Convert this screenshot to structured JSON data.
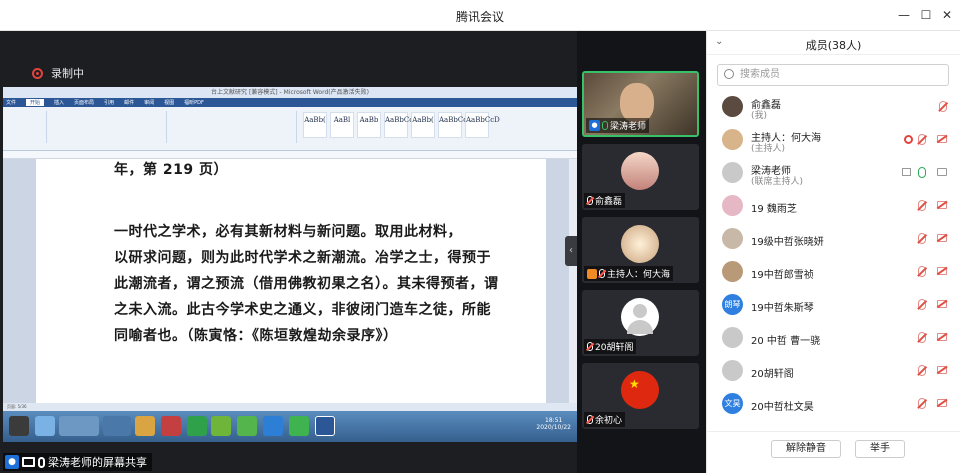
{
  "window": {
    "title": "腾讯会议"
  },
  "recording": {
    "label": "录制中"
  },
  "word": {
    "title": "台上文献研究 [兼容模式] - Microsoft Word(产品激活失败)",
    "menu": [
      "文件",
      "开始",
      "插入",
      "页面布局",
      "引用",
      "邮件",
      "审阅",
      "视图",
      "福昕PDF"
    ],
    "styles": [
      "AaBb(",
      "AaBl",
      "AaBb",
      "AaBbCc",
      "AaBb(",
      "AaBbCcD",
      "AaBbCcD"
    ],
    "doc_lines": [
      "年，第 219 页）",
      "一时代之学术，必有其新材料与新问题。取用此材料，",
      "以研求问题，则为此时代学术之新潮流。冶学之士，得预于",
      "此潮流者，谓之预流（借用佛教初果之名）。其未得预者，谓",
      "之未入流。此古今学术史之通义，非彼闭门造车之徒，所能",
      "同喻者也。（陈寅恪：《陈垣敦煌劫余录序》）"
    ],
    "clock": {
      "time": "18:51",
      "date": "2020/10/22"
    },
    "page_no": "页面: 5/36"
  },
  "share_label": "梁涛老师的屏幕共享",
  "videos": [
    {
      "name": "梁涛老师",
      "active": true
    },
    {
      "name": "俞鑫磊",
      "active": false
    },
    {
      "name": "主持人：何大海",
      "active": false
    },
    {
      "name": "20胡轩阁",
      "active": false
    },
    {
      "name": "余初心",
      "active": false
    }
  ],
  "panel": {
    "title": "成员(38人)",
    "search_placeholder": "搜索成员",
    "members": [
      {
        "name": "俞鑫磊",
        "sub": "(我)",
        "avatar_text": ""
      },
      {
        "name": "主持人：何大海",
        "sub": "(主持人)",
        "avatar_text": ""
      },
      {
        "name": "梁涛老师",
        "sub": "(联席主持人)",
        "avatar_text": ""
      },
      {
        "name": "19 魏雨芝",
        "sub": "",
        "avatar_text": ""
      },
      {
        "name": "19级中哲张晓妍",
        "sub": "",
        "avatar_text": ""
      },
      {
        "name": "19中哲郎雪祯",
        "sub": "",
        "avatar_text": ""
      },
      {
        "name": "19中哲朱斯琴",
        "sub": "",
        "avatar_text": "朗琴"
      },
      {
        "name": "20 中哲 曹一骁",
        "sub": "",
        "avatar_text": ""
      },
      {
        "name": "20胡轩阁",
        "sub": "",
        "avatar_text": ""
      },
      {
        "name": "20中哲杜文昊",
        "sub": "",
        "avatar_text": "文昊"
      }
    ],
    "unmute_all": "解除静音",
    "raise_hand": "举手"
  },
  "colors": {
    "accent": "#1f6fd8",
    "recording": "#e0443c",
    "active_speaker": "#38c06a"
  }
}
